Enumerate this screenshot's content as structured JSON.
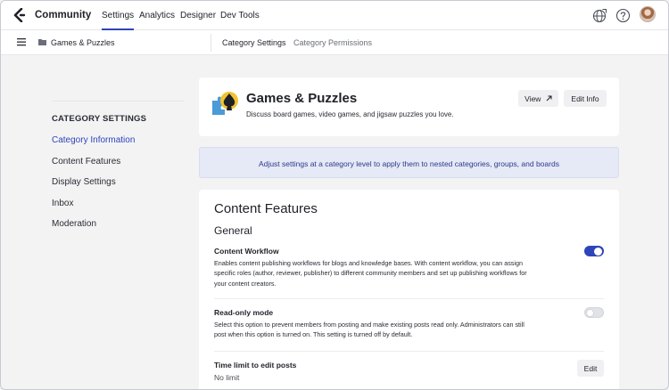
{
  "topnav": {
    "brand": "Community",
    "tabs": [
      {
        "label": "Settings",
        "active": true
      },
      {
        "label": "Analytics"
      },
      {
        "label": "Designer"
      },
      {
        "label": "Dev Tools"
      }
    ],
    "icons": [
      "globe-icon",
      "help-icon",
      "user-avatar"
    ]
  },
  "subbar": {
    "breadcrumb": "Games & Puzzles",
    "tabs": [
      {
        "label": "Category Settings",
        "active": true
      },
      {
        "label": "Category Permissions"
      }
    ]
  },
  "sidebar": {
    "heading": "CATEGORY SETTINGS",
    "items": [
      {
        "label": "Category Information",
        "active": true
      },
      {
        "label": "Content Features"
      },
      {
        "label": "Display Settings"
      },
      {
        "label": "Inbox"
      },
      {
        "label": "Moderation"
      }
    ]
  },
  "category": {
    "title": "Games & Puzzles",
    "description": "Discuss board games, video games, and jigsaw puzzles you love.",
    "view_label": "View",
    "edit_label": "Edit Info"
  },
  "notice": "Adjust settings at a category level to apply them to nested categories, groups, and boards",
  "content_features": {
    "title": "Content Features",
    "section": "General",
    "settings": [
      {
        "title": "Content Workflow",
        "desc1": "Enables content publishing workflows for blogs and knowledge bases. With content workflow, you can assign",
        "desc2": "specific roles (author, reviewer, publisher) to different community members and set up publishing workflows for",
        "desc3": "your content creators.",
        "enabled": true
      },
      {
        "title": "Read-only mode",
        "desc1": "Select this option to prevent members from posting and make existing posts read only. Administrators can still",
        "desc2": "post when this option is turned on. This setting is turned off by default.",
        "enabled": false
      },
      {
        "title": "Time limit to edit posts",
        "value": "No limit",
        "edit_label": "Edit"
      }
    ]
  },
  "colors": {
    "accent": "#2f44b8",
    "notice_bg": "#e6e9f6",
    "page_bg": "#f3f3f4"
  }
}
